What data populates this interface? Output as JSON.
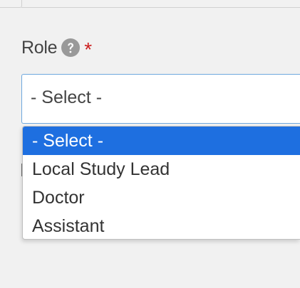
{
  "field": {
    "label": "Role",
    "help_icon": "question-circle-icon",
    "required_marker": "*",
    "required_color": "#cc1f1f"
  },
  "select": {
    "current_value": "- Select -",
    "border_color": "#6fa8de"
  },
  "dropdown": {
    "highlight_color": "#1e6fe0",
    "options": [
      {
        "label": "- Select -",
        "selected": true
      },
      {
        "label": "Local Study Lead",
        "selected": false
      },
      {
        "label": "Doctor",
        "selected": false
      },
      {
        "label": "Assistant",
        "selected": false
      }
    ]
  }
}
